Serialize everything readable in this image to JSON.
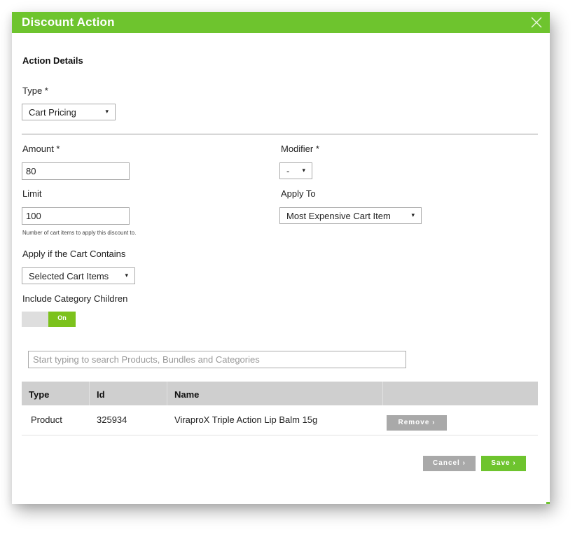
{
  "dialog": {
    "title": "Discount Action",
    "close_icon": "close-x-icon",
    "section_title": "Action Details"
  },
  "form": {
    "type": {
      "label": "Type *",
      "value": "Cart Pricing"
    },
    "amount": {
      "label": "Amount *",
      "value": "80"
    },
    "modifier": {
      "label": "Modifier *",
      "value": "-"
    },
    "limit": {
      "label": "Limit",
      "value": "100",
      "hint": "Number of cart items to apply this discount to."
    },
    "apply_to": {
      "label": "Apply To",
      "value": "Most Expensive Cart Item"
    },
    "apply_if": {
      "label": "Apply if the Cart Contains",
      "value": "Selected Cart Items"
    },
    "include_children": {
      "label": "Include Category Children",
      "state_label": "On",
      "enabled": true
    },
    "dropdown_arrow": "▾"
  },
  "search": {
    "placeholder": "Start typing to search Products, Bundles and Categories"
  },
  "table": {
    "columns": [
      "Type",
      "Id",
      "Name",
      ""
    ],
    "rows": [
      {
        "type": "Product",
        "id": "325934",
        "name": "ViraproX Triple Action Lip Balm 15g",
        "action": "Remove  ›"
      }
    ]
  },
  "footer": {
    "cancel_label": "Cancel  ›",
    "save_label": "Save  ›"
  },
  "colors": {
    "accent": "#6ec42e",
    "toggle_on": "#7cc21c",
    "button_grey": "#a9a9a9",
    "table_header": "#cfcfcf"
  }
}
